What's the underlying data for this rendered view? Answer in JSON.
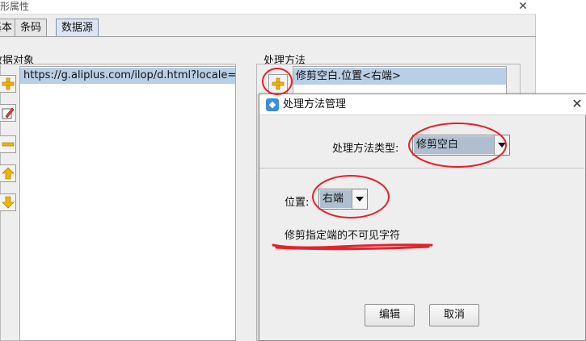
{
  "parent": {
    "title": "图形属性",
    "tabs": [
      {
        "label": "基本"
      },
      {
        "label": "条码"
      },
      {
        "label": "数据源"
      }
    ],
    "data_object_label": "数据对象",
    "data_object_value": "https://g.aliplus.com/ilop/d.html?locale=zh-",
    "method_label": "处理方法",
    "method_value": "修剪空白.位置<右端>"
  },
  "dialog": {
    "title": "处理方法管理",
    "type_label": "处理方法类型:",
    "type_value": "修剪空白",
    "position_label": "位置:",
    "position_value": "右端",
    "description": "修剪指定端的不可见字符",
    "edit_button": "编辑",
    "cancel_button": "取消"
  },
  "annotation_color": "#e8202a"
}
